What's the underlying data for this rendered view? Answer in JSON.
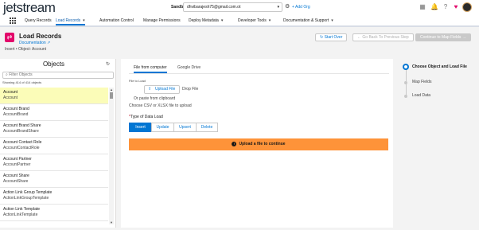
{
  "header": {
    "logo": "jetstream",
    "sandbox_label": "Sandbox",
    "org_email": "dhvibarajesh75@gmail.com.ot",
    "add_org": "+ Add Org"
  },
  "nav": {
    "items": [
      {
        "label": "Query Records",
        "has_menu": false
      },
      {
        "label": "Load Records",
        "has_menu": true
      },
      {
        "label": "Automation Control",
        "has_menu": false
      },
      {
        "label": "Manage Permissions",
        "has_menu": false
      },
      {
        "label": "Deploy Metadata",
        "has_menu": true
      },
      {
        "label": "Developer Tools",
        "has_menu": true
      },
      {
        "label": "Documentation & Support",
        "has_menu": true
      }
    ],
    "active_index": 1
  },
  "page": {
    "title": "Load Records",
    "documentation_link": "Documentation",
    "breadcrumb": "Insert • Object: Account",
    "start_over": "Start Over",
    "go_back": "← Go Back To Previous Step",
    "continue": "Continue to Map Fields →"
  },
  "objects": {
    "title": "Objects",
    "filter_placeholder": "Filter Objects",
    "count_text": "Showing 414 of 414 objects",
    "items": [
      {
        "label": "Account",
        "api": "Account",
        "selected": true
      },
      {
        "label": "Account Brand",
        "api": "AccountBrand",
        "selected": false
      },
      {
        "label": "Account Brand Share",
        "api": "AccountBrandShare",
        "selected": false
      },
      {
        "label": "Account Contact Role",
        "api": "AccountContactRole",
        "selected": false
      },
      {
        "label": "Account Partner",
        "api": "AccountPartner",
        "selected": false
      },
      {
        "label": "Account Share",
        "api": "AccountShare",
        "selected": false
      },
      {
        "label": "Action Link Group Template",
        "api": "ActionLinkGroupTemplate",
        "selected": false
      },
      {
        "label": "Action Link Template",
        "api": "ActionLinkTemplate",
        "selected": false
      }
    ]
  },
  "main": {
    "tabs": [
      {
        "label": "File from computer",
        "active": true
      },
      {
        "label": "Google Drive",
        "active": false
      }
    ],
    "file_label": "File to Load",
    "upload_button": "Upload File",
    "drop_text": "Drop File",
    "paste_text": "Or paste from clipboard",
    "choose_text": "Choose CSV or XLSX file to upload",
    "type_label": "Type of Data Load",
    "type_required_mark": "*",
    "load_types": [
      "Insert",
      "Update",
      "Upsert",
      "Delete"
    ],
    "selected_load_type": "Insert",
    "banner": "Upload a file to continue"
  },
  "steps": {
    "items": [
      {
        "label": "Choose Object and Load File",
        "active": true
      },
      {
        "label": "Map Fields",
        "active": false
      },
      {
        "label": "Load Data",
        "active": false
      }
    ]
  },
  "colors": {
    "brand": "#0176d3",
    "banner": "#fe9339",
    "selected_row": "#fbfcb8",
    "page_icon": "#e3066a"
  },
  "icons": {
    "org_chevron": "▾",
    "org_settings": "⚙",
    "header": [
      "calendar-icon",
      "bell-icon",
      "help-icon",
      "heart-icon"
    ],
    "header_glyphs": [
      "▦",
      "🔔",
      "?",
      "♥"
    ],
    "refresh": "↻",
    "search": "⌕",
    "upload": "⇧",
    "warning": "!",
    "page_icon": "⇄",
    "launcher": "grid-icon",
    "external_link": "↗",
    "scroll_up": "▲",
    "scroll_down": "▼"
  }
}
